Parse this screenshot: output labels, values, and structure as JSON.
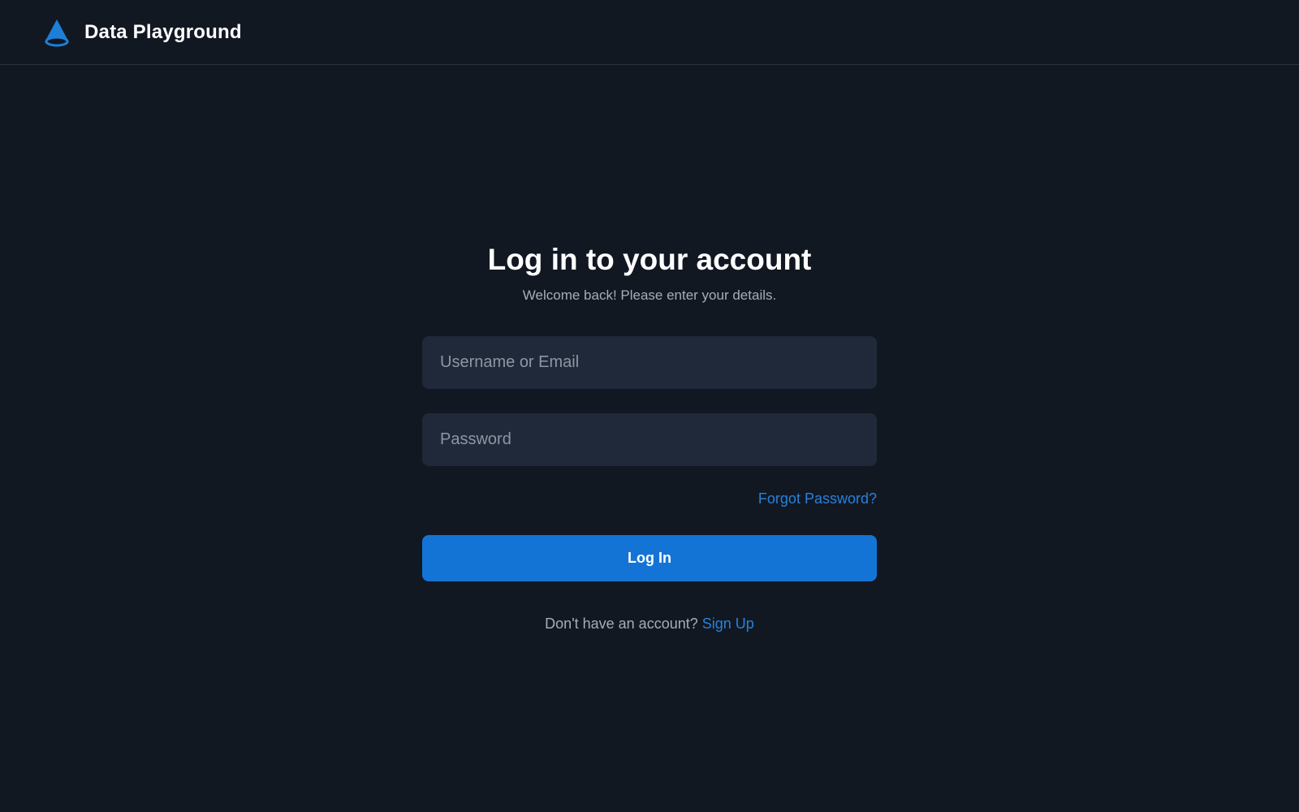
{
  "header": {
    "brand": "Data Playground",
    "logo_icon": "cone-icon",
    "accent": "#1e7fd8"
  },
  "login": {
    "title": "Log in to your account",
    "subtitle": "Welcome back! Please enter your details.",
    "username": {
      "placeholder": "Username or Email",
      "value": ""
    },
    "password": {
      "placeholder": "Password",
      "value": ""
    },
    "forgot_label": "Forgot Password?",
    "submit_label": "Log In",
    "signup_prompt": "Don't have an account?",
    "signup_label": "Sign Up"
  },
  "colors": {
    "background": "#111822",
    "input_background": "#1f2939",
    "primary_button": "#1374d6",
    "link": "#2b80d9",
    "muted_text": "#a6adb8"
  }
}
